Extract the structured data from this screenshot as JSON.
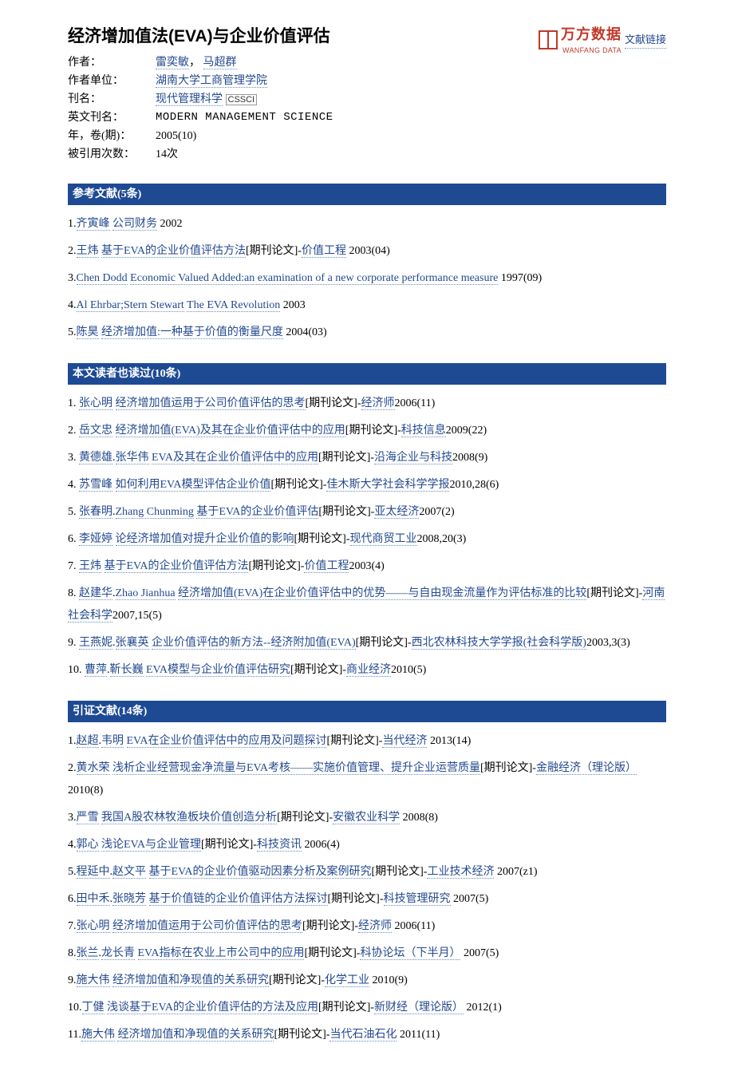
{
  "header": {
    "title": "经济增加值法(EVA)与企业价值评估",
    "logo_cn": "万方数据",
    "logo_en": "WANFANG DATA",
    "logo_link": "文献链接",
    "meta": {
      "author_label": "作者：",
      "authors": [
        "雷奕敏",
        "马超群"
      ],
      "author_sep": "，  ",
      "unit_label": "作者单位：",
      "unit": "湖南大学工商管理学院",
      "journal_label": "刊名：",
      "journal": "现代管理科学",
      "journal_badge": "CSSCI",
      "en_journal_label": "英文刊名：",
      "en_journal": "MODERN MANAGEMENT SCIENCE",
      "yvi_label": "年，卷(期)：",
      "yvi": "2005(10)",
      "cited_label": "被引用次数：",
      "cited": "14次"
    }
  },
  "sections": {
    "refs_title": "参考文献(5条)",
    "readers_title": "本文读者也读过(10条)",
    "citing_title": "引证文献(14条)"
  },
  "refs": [
    {
      "idx": "1.",
      "authors": [
        "齐寅峰"
      ],
      "title": "公司财务",
      "suffix": " 2002"
    },
    {
      "idx": "2.",
      "authors": [
        "王炜"
      ],
      "title": "基于EVA的企业价值评估方法",
      "mid": "[期刊论文]-",
      "link2": "价值工程",
      "suffix": " 2003(04)"
    },
    {
      "idx": "3.",
      "authors": [
        "Chen Dodd"
      ],
      "title": "Economic Valued Added:an examination of a new corporate performance measure",
      "suffix": " 1997(09)"
    },
    {
      "idx": "4.",
      "authors": [
        "Al Ehrbar;Stern Stewart"
      ],
      "title": "The EVA Revolution",
      "suffix": " 2003"
    },
    {
      "idx": "5.",
      "authors": [
        "陈昊"
      ],
      "title": "经济增加值:一种基于价值的衡量尺度",
      "suffix": " 2004(03)"
    }
  ],
  "readers": [
    {
      "idx": "1. ",
      "authors": [
        "张心明"
      ],
      "title": "经济增加值运用于公司价值评估的思考",
      "mid": "[期刊论文]-",
      "link2": "经济师",
      "suffix": "2006(11)"
    },
    {
      "idx": "2. ",
      "authors": [
        "岳文忠"
      ],
      "title": "经济增加值(EVA)及其在企业价值评估中的应用",
      "mid": "[期刊论文]-",
      "link2": "科技信息",
      "suffix": "2009(22)"
    },
    {
      "idx": "3. ",
      "authors": [
        "黄德雄",
        "张华伟"
      ],
      "title": "EVA及其在企业价值评估中的应用",
      "mid": "[期刊论文]-",
      "link2": "沿海企业与科技",
      "suffix": "2008(9)"
    },
    {
      "idx": "4. ",
      "authors": [
        "苏雪峰"
      ],
      "title": "如何利用EVA模型评估企业价值",
      "mid": "[期刊论文]-",
      "link2": "佳木斯大学社会科学学报",
      "suffix": "2010,28(6)"
    },
    {
      "idx": "5. ",
      "authors": [
        "张春明",
        "Zhang Chunming"
      ],
      "title": "基于EVA的企业价值评估",
      "mid": "[期刊论文]-",
      "link2": "亚太经济",
      "suffix": "2007(2)"
    },
    {
      "idx": "6. ",
      "authors": [
        "李娅婷"
      ],
      "title": "论经济增加值对提升企业价值的影响",
      "mid": "[期刊论文]-",
      "link2": "现代商贸工业",
      "suffix": "2008,20(3)"
    },
    {
      "idx": "7. ",
      "authors": [
        "王炜"
      ],
      "title": "基于EVA的企业价值评估方法",
      "mid": "[期刊论文]-",
      "link2": "价值工程",
      "suffix": "2003(4)"
    },
    {
      "idx": "8. ",
      "authors": [
        "赵建华",
        "Zhao Jianhua"
      ],
      "title": "经济增加值(EVA)在企业价值评估中的优势——与自由现金流量作为评估标准的比较",
      "mid": "[期刊论文]-",
      "link2": "河南社会科学",
      "suffix": "2007,15(5)"
    },
    {
      "idx": "9. ",
      "authors": [
        "王燕妮",
        "张襄英"
      ],
      "title": "企业价值评估的新方法--经济附加值(EVA)",
      "mid": "[期刊论文]-",
      "link2": "西北农林科技大学学报(社会科学版)",
      "suffix": "2003,3(3)"
    },
    {
      "idx": "10. ",
      "authors": [
        "曹萍",
        "靳长巍"
      ],
      "title": "EVA模型与企业价值评估研究",
      "mid": "[期刊论文]-",
      "link2": "商业经济",
      "suffix": "2010(5)"
    }
  ],
  "citing": [
    {
      "idx": "1.",
      "authors": [
        "赵超",
        "韦明"
      ],
      "title": "EVA在企业价值评估中的应用及问题探讨",
      "mid": "[期刊论文]-",
      "link2": "当代经济",
      "suffix": " 2013(14)"
    },
    {
      "idx": "2.",
      "authors": [
        "黄水荣"
      ],
      "title": "浅析企业经营现金净流量与EVA考核——实施价值管理、提升企业运营质量",
      "mid": "[期刊论文]-",
      "link2": "金融经济（理论版）",
      "suffix": " 2010(8)"
    },
    {
      "idx": "3.",
      "authors": [
        "严雪"
      ],
      "title": "我国A股农林牧渔板块价值创造分析",
      "mid": "[期刊论文]-",
      "link2": "安徽农业科学",
      "suffix": " 2008(8)"
    },
    {
      "idx": "4.",
      "authors": [
        "郭心"
      ],
      "title": "浅论EVA与企业管理",
      "mid": "[期刊论文]-",
      "link2": "科技资讯",
      "suffix": " 2006(4)"
    },
    {
      "idx": "5.",
      "authors": [
        "程延中",
        "赵文平"
      ],
      "title": "基于EVA的企业价值驱动因素分析及案例研究",
      "mid": "[期刊论文]-",
      "link2": "工业技术经济",
      "suffix": " 2007(z1)"
    },
    {
      "idx": "6.",
      "authors": [
        "田中禾",
        "张晓芳"
      ],
      "title": "基于价值链的企业价值评估方法探讨",
      "mid": "[期刊论文]-",
      "link2": "科技管理研究",
      "suffix": " 2007(5)"
    },
    {
      "idx": "7.",
      "authors": [
        "张心明"
      ],
      "title": "经济增加值运用于公司价值评估的思考",
      "mid": "[期刊论文]-",
      "link2": "经济师",
      "suffix": " 2006(11)"
    },
    {
      "idx": "8.",
      "authors": [
        "张兰",
        "龙长青"
      ],
      "title": "EVA指标在农业上市公司中的应用",
      "mid": "[期刊论文]-",
      "link2": "科协论坛（下半月）",
      "suffix": " 2007(5)"
    },
    {
      "idx": "9.",
      "authors": [
        "施大伟"
      ],
      "title": "经济增加值和净现值的关系研究",
      "mid": "[期刊论文]-",
      "link2": "化学工业",
      "suffix": " 2010(9)"
    },
    {
      "idx": "10.",
      "authors": [
        "丁健"
      ],
      "title": "浅谈基于EVA的企业价值评估的方法及应用",
      "mid": "[期刊论文]-",
      "link2": "新财经（理论版）",
      "suffix": " 2012(1)"
    },
    {
      "idx": "11.",
      "authors": [
        "施大伟"
      ],
      "title": "经济增加值和净现值的关系研究",
      "mid": "[期刊论文]-",
      "link2": "当代石油石化",
      "suffix": " 2011(11)"
    }
  ]
}
